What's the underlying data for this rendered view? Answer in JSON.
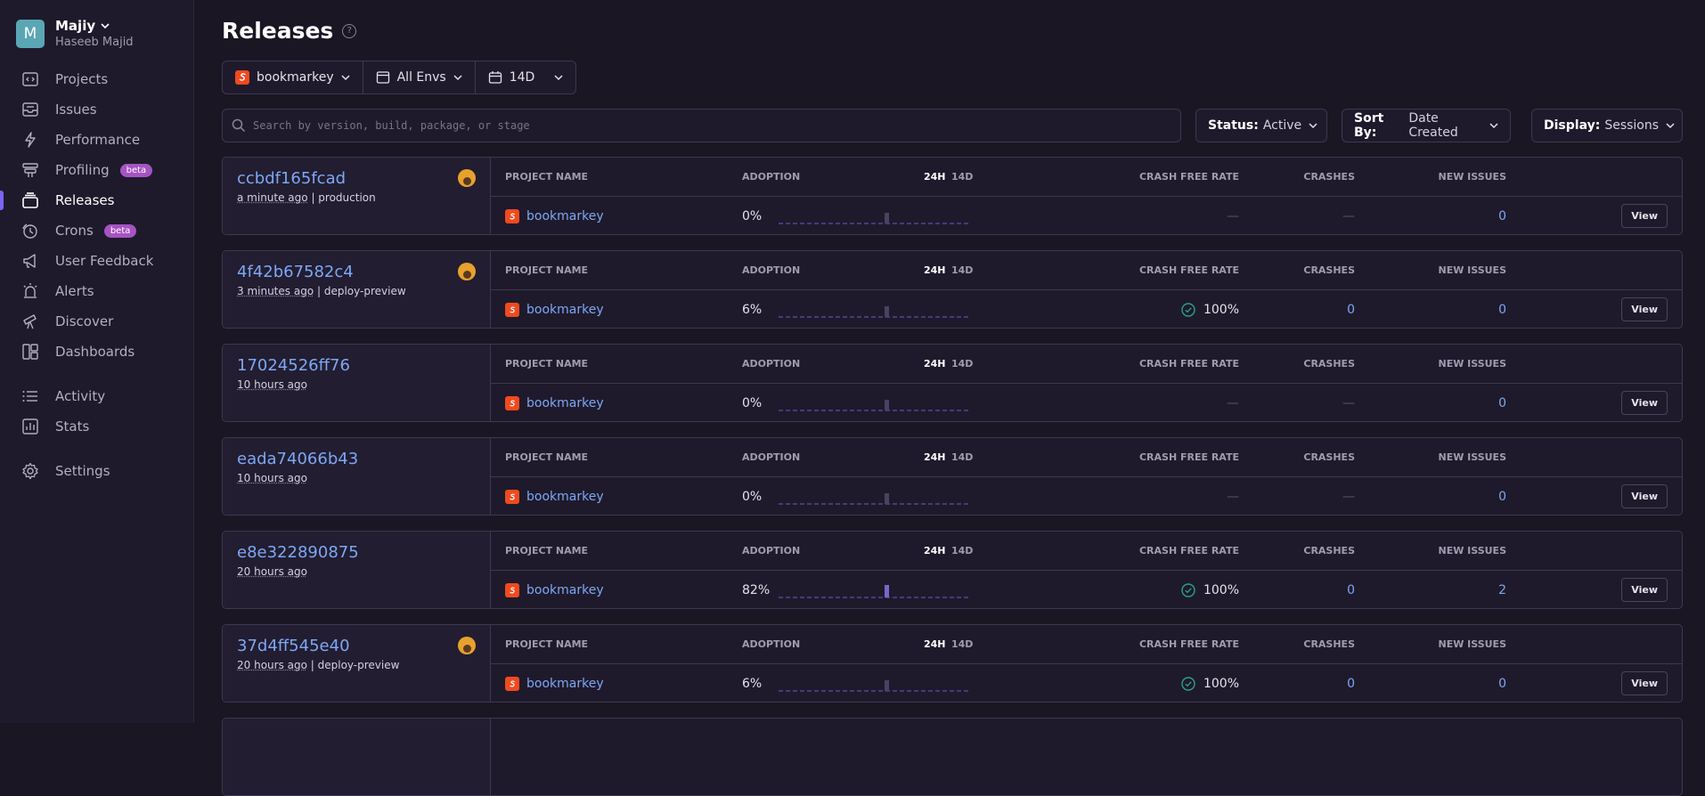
{
  "org": {
    "initial": "M",
    "name": "Majiy",
    "user": "Haseeb Majid"
  },
  "nav": [
    {
      "label": "Projects",
      "icon": "code-icon"
    },
    {
      "label": "Issues",
      "icon": "inbox-icon"
    },
    {
      "label": "Performance",
      "icon": "lightning-icon"
    },
    {
      "label": "Profiling",
      "icon": "profiling-icon",
      "badge": "beta"
    },
    {
      "label": "Releases",
      "icon": "releases-icon",
      "active": true
    },
    {
      "label": "Crons",
      "icon": "timer-icon",
      "badge": "beta"
    },
    {
      "label": "User Feedback",
      "icon": "megaphone-icon"
    },
    {
      "label": "Alerts",
      "icon": "siren-icon"
    },
    {
      "label": "Discover",
      "icon": "telescope-icon"
    },
    {
      "label": "Dashboards",
      "icon": "dashboard-icon"
    },
    {
      "label": "Activity",
      "icon": "list-icon"
    },
    {
      "label": "Stats",
      "icon": "stats-icon"
    },
    {
      "label": "Settings",
      "icon": "gear-icon"
    }
  ],
  "page": {
    "title": "Releases"
  },
  "filters": {
    "project": "bookmarkey",
    "env": "All Envs",
    "period": "14D"
  },
  "search": {
    "placeholder": "Search by version, build, package, or stage"
  },
  "controls": {
    "status_label": "Status:",
    "status_value": "Active",
    "sort_label": "Sort By:",
    "sort_value": "Date Created",
    "display_label": "Display:",
    "display_value": "Sessions"
  },
  "headers": {
    "project": "PROJECT NAME",
    "adoption": "ADOPTION",
    "h24": "24H",
    "d14": "14D",
    "cfr": "CRASH FREE RATE",
    "crashes": "CRASHES",
    "new_issues": "NEW ISSUES"
  },
  "view_label": "View",
  "colors": {
    "accent": "#7d62f5",
    "link": "#7ea7f5",
    "success": "#2ba185",
    "project_icon": "#f04a1f"
  },
  "releases": [
    {
      "version": "ccbdf165fcad",
      "ago": "a minute ago",
      "env": "production",
      "author": true,
      "project": "bookmarkey",
      "adoption": "0%",
      "adoption_value": 0,
      "cfr": "—",
      "crashes": "—",
      "new_issues": "0"
    },
    {
      "version": "4f42b67582c4",
      "ago": "3 minutes ago",
      "env": "deploy-preview",
      "author": true,
      "project": "bookmarkey",
      "adoption": "6%",
      "adoption_value": 6,
      "cfr": "100%",
      "crashes": "0",
      "new_issues": "0"
    },
    {
      "version": "17024526ff76",
      "ago": "10 hours ago",
      "env": "",
      "author": false,
      "project": "bookmarkey",
      "adoption": "0%",
      "adoption_value": 0,
      "cfr": "—",
      "crashes": "—",
      "new_issues": "0"
    },
    {
      "version": "eada74066b43",
      "ago": "10 hours ago",
      "env": "",
      "author": false,
      "project": "bookmarkey",
      "adoption": "0%",
      "adoption_value": 0,
      "cfr": "—",
      "crashes": "—",
      "new_issues": "0"
    },
    {
      "version": "e8e322890875",
      "ago": "20 hours ago",
      "env": "",
      "author": false,
      "project": "bookmarkey",
      "adoption": "82%",
      "adoption_value": 82,
      "cfr": "100%",
      "crashes": "0",
      "new_issues": "2"
    },
    {
      "version": "37d4ff545e40",
      "ago": "20 hours ago",
      "env": "deploy-preview",
      "author": true,
      "project": "bookmarkey",
      "adoption": "6%",
      "adoption_value": 6,
      "cfr": "100%",
      "crashes": "0",
      "new_issues": "0"
    }
  ]
}
